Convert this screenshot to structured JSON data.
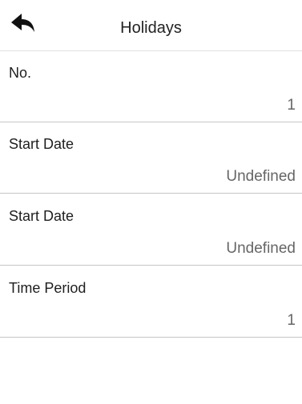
{
  "header": {
    "back_icon": "back-arrow-icon",
    "title": "Holidays"
  },
  "fields": [
    {
      "label": "No.",
      "value": "1"
    },
    {
      "label": "Start Date",
      "value": "Undefined"
    },
    {
      "label": "Start Date",
      "value": "Undefined"
    },
    {
      "label": "Time Period",
      "value": "1"
    }
  ]
}
